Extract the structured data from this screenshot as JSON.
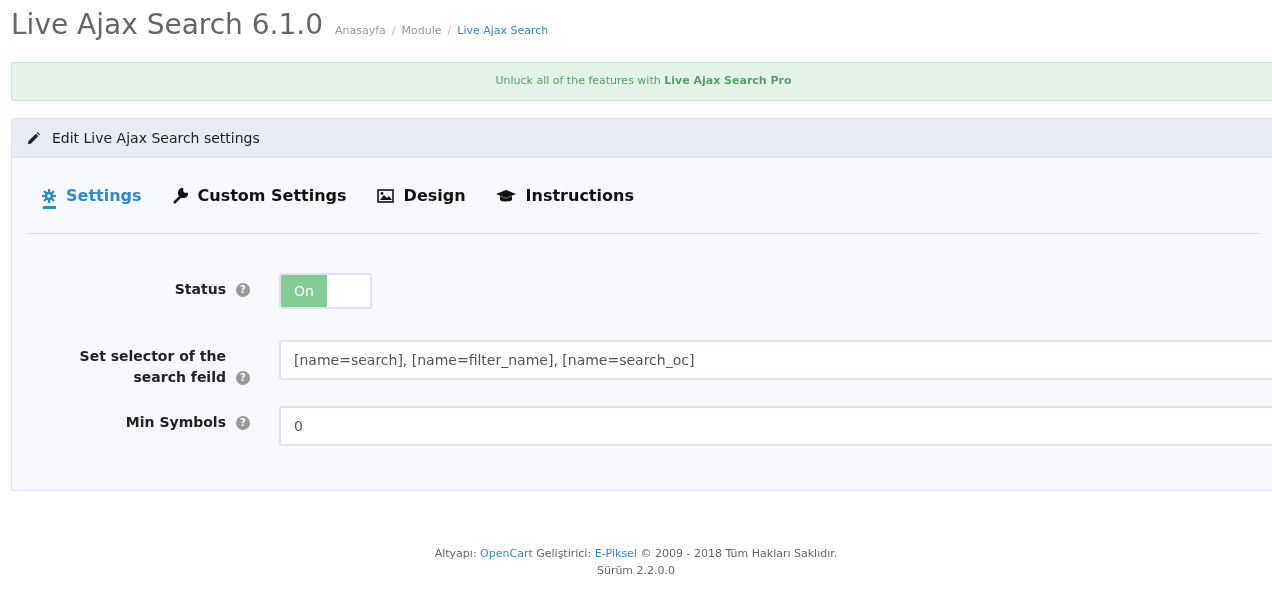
{
  "header": {
    "title": "Live Ajax Search 6.1.0",
    "breadcrumbs": [
      {
        "label": "Anasayfa",
        "selected": false
      },
      {
        "separator": "/",
        "label": "Module",
        "selected": false
      },
      {
        "separator": "/",
        "label": "Live Ajax Search",
        "selected": true
      }
    ]
  },
  "alert": {
    "text": "Unluck all of the features with **Live Ajax Search Pro**"
  },
  "panel": {
    "title": "Edit Live Ajax Search settings",
    "tabs": [
      {
        "label": "Settings",
        "selected": true
      },
      {
        "label": "Custom Settings",
        "selected": false
      },
      {
        "label": "Design",
        "selected": false
      },
      {
        "label": "Instructions",
        "selected": false
      }
    ],
    "fields": [
      {
        "kind": "toggle",
        "label": "Status",
        "help": "?",
        "on": true,
        "on_label": "On"
      },
      {
        "kind": "input",
        "label": "Set selector of the search feild",
        "help": "?",
        "value": "[name=search], [name=filter_name], [name=search_oc]"
      },
      {
        "kind": "input",
        "label": "Min Symbols",
        "help": "?",
        "value": "0"
      }
    ]
  },
  "footer": {
    "line1": [
      {
        "kind": "text",
        "text": "Altyapı:"
      },
      {
        "kind": "link",
        "text": "OpenCart"
      },
      {
        "kind": "text",
        "text": "Geliştirici:"
      },
      {
        "kind": "link",
        "text": "E-Piksel"
      },
      {
        "kind": "text",
        "text": "© 2009 - 2018 Tüm Hakları Saklıdır."
      }
    ],
    "line2": "Sürüm 2.2.0.0"
  }
}
